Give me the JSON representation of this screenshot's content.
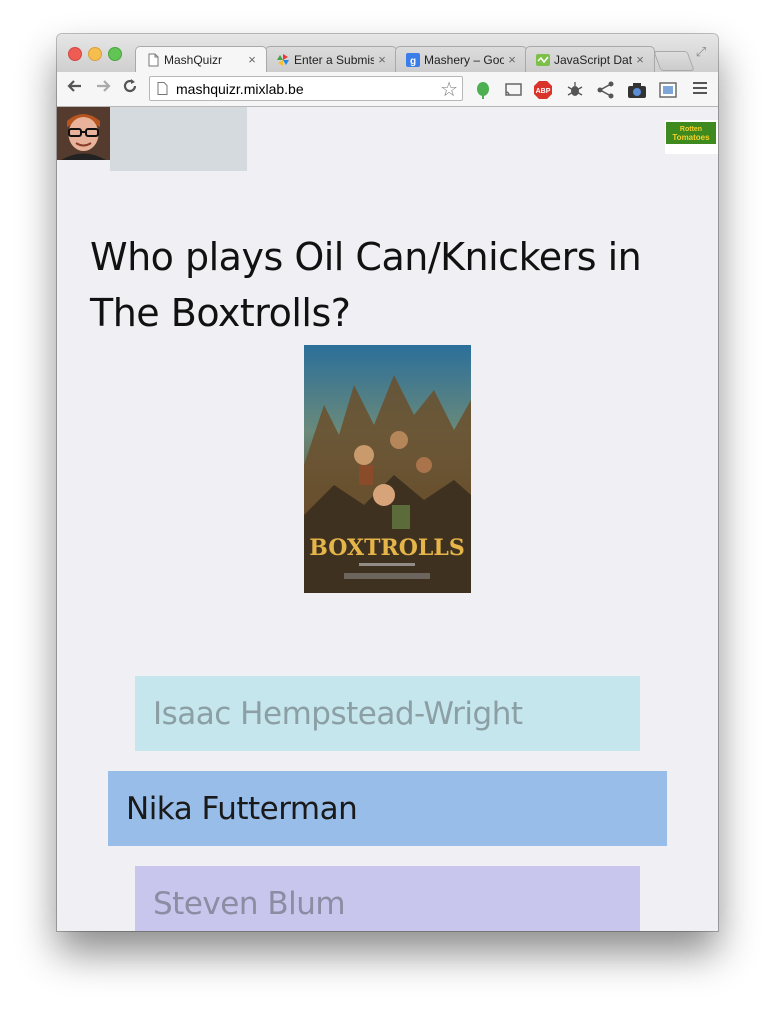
{
  "browser": {
    "tabs": [
      {
        "title": "MashQuizr",
        "active": true
      },
      {
        "title": "Enter a Submis",
        "active": false
      },
      {
        "title": "Mashery – Goo",
        "active": false
      },
      {
        "title": "JavaScript Date",
        "active": false
      }
    ],
    "close_glyph": "×",
    "url": "mashquizr.mixlab.be"
  },
  "icons": {
    "back": "arrow-left-icon",
    "forward": "arrow-right-icon",
    "reload": "reload-icon",
    "bookmark": "star-icon",
    "extensions": [
      "evernote-icon",
      "cast-icon",
      "adblock-plus-icon",
      "bug-icon",
      "share-icon",
      "camera-icon",
      "screenshot-icon"
    ],
    "menu": "hamburger-menu-icon"
  },
  "quiz": {
    "question": "Who plays Oil Can/Knickers in The Boxtrolls?",
    "poster_title": "BOXTROLLS",
    "answers": [
      {
        "label": "Isaac Hempstead-Wright",
        "state": "dimmed"
      },
      {
        "label": "Nika Futterman",
        "state": "highlighted"
      },
      {
        "label": "Steven Blum",
        "state": "dimmed"
      }
    ]
  },
  "logos": {
    "rotten_tomatoes_line1": "Rotten",
    "rotten_tomatoes_line2": "Tomatoes"
  },
  "colors": {
    "page_background": "#f0eff4",
    "answer_1": "#c5e6ed",
    "answer_2": "#98bde9",
    "answer_3": "#c8c6ed",
    "grey_block": "#d4dadd"
  }
}
